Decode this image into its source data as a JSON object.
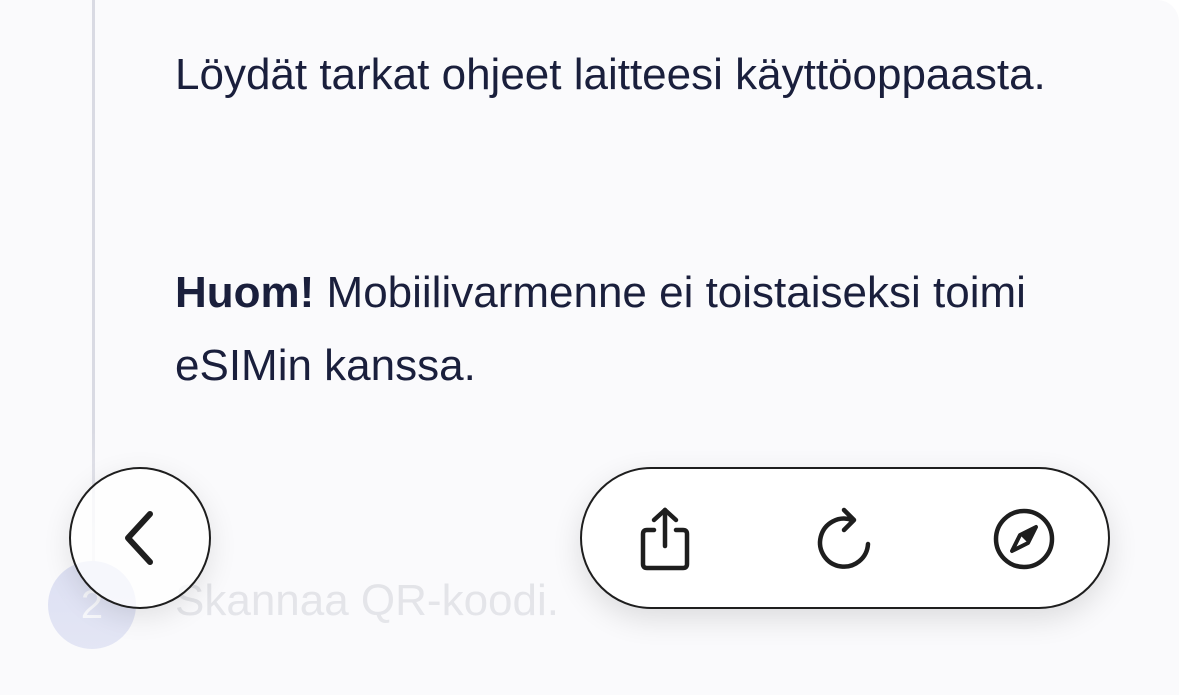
{
  "content": {
    "paragraph1": "Löydät tarkat ohjeet laitteesi käyttöoppaasta.",
    "note_label": "Huom!",
    "note_text": " Mobiilivarmenne ei toistaiseksi toimi eSIMin kanssa."
  },
  "step2": {
    "number": "2",
    "label": "Skannaa QR-koodi."
  },
  "toolbar": {
    "back_icon": "chevron-left-icon",
    "share_icon": "share-icon",
    "reload_icon": "reload-icon",
    "compass_icon": "compass-icon"
  },
  "colors": {
    "text": "#1a1f3c",
    "step_badge": "#b8bfe7",
    "step_label_faded": "#c2c4cc",
    "background": "#fafafc"
  }
}
